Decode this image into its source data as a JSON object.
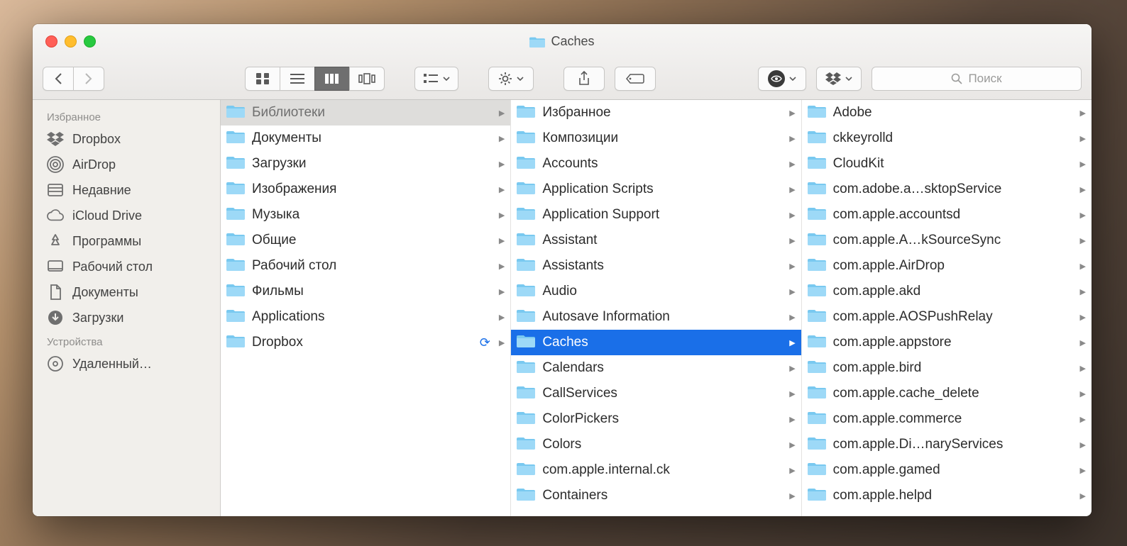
{
  "window": {
    "title": "Caches"
  },
  "search": {
    "placeholder": "Поиск"
  },
  "sidebar": {
    "sections": [
      {
        "title": "Избранное",
        "items": [
          {
            "label": "Dropbox",
            "icon": "dropbox"
          },
          {
            "label": "AirDrop",
            "icon": "airdrop"
          },
          {
            "label": "Недавние",
            "icon": "recents"
          },
          {
            "label": "iCloud Drive",
            "icon": "cloud"
          },
          {
            "label": "Программы",
            "icon": "apps"
          },
          {
            "label": "Рабочий стол",
            "icon": "desktop"
          },
          {
            "label": "Документы",
            "icon": "docs"
          },
          {
            "label": "Загрузки",
            "icon": "downloads"
          }
        ]
      },
      {
        "title": "Устройства",
        "items": [
          {
            "label": "Удаленный…",
            "icon": "disc"
          }
        ]
      }
    ]
  },
  "columns": [
    {
      "items": [
        {
          "label": "Библиотеки",
          "selectedParent": true
        },
        {
          "label": "Документы"
        },
        {
          "label": "Загрузки"
        },
        {
          "label": "Изображения"
        },
        {
          "label": "Музыка"
        },
        {
          "label": "Общие"
        },
        {
          "label": "Рабочий стол"
        },
        {
          "label": "Фильмы"
        },
        {
          "label": "Applications"
        },
        {
          "label": "Dropbox",
          "sync": true
        }
      ]
    },
    {
      "items": [
        {
          "label": "Избранное"
        },
        {
          "label": "Композиции"
        },
        {
          "label": "Accounts"
        },
        {
          "label": "Application Scripts"
        },
        {
          "label": "Application Support"
        },
        {
          "label": "Assistant"
        },
        {
          "label": "Assistants"
        },
        {
          "label": "Audio"
        },
        {
          "label": "Autosave Information"
        },
        {
          "label": "Caches",
          "selected": true
        },
        {
          "label": "Calendars"
        },
        {
          "label": "CallServices"
        },
        {
          "label": "ColorPickers"
        },
        {
          "label": "Colors"
        },
        {
          "label": "com.apple.internal.ck"
        },
        {
          "label": "Containers"
        }
      ]
    },
    {
      "items": [
        {
          "label": "Adobe"
        },
        {
          "label": "ckkeyrolld"
        },
        {
          "label": "CloudKit"
        },
        {
          "label": "com.adobe.a…sktopService"
        },
        {
          "label": "com.apple.accountsd"
        },
        {
          "label": "com.apple.A…kSourceSync"
        },
        {
          "label": "com.apple.AirDrop"
        },
        {
          "label": "com.apple.akd"
        },
        {
          "label": "com.apple.AOSPushRelay"
        },
        {
          "label": "com.apple.appstore"
        },
        {
          "label": "com.apple.bird"
        },
        {
          "label": "com.apple.cache_delete"
        },
        {
          "label": "com.apple.commerce"
        },
        {
          "label": "com.apple.Di…naryServices"
        },
        {
          "label": "com.apple.gamed"
        },
        {
          "label": "com.apple.helpd"
        }
      ]
    }
  ]
}
